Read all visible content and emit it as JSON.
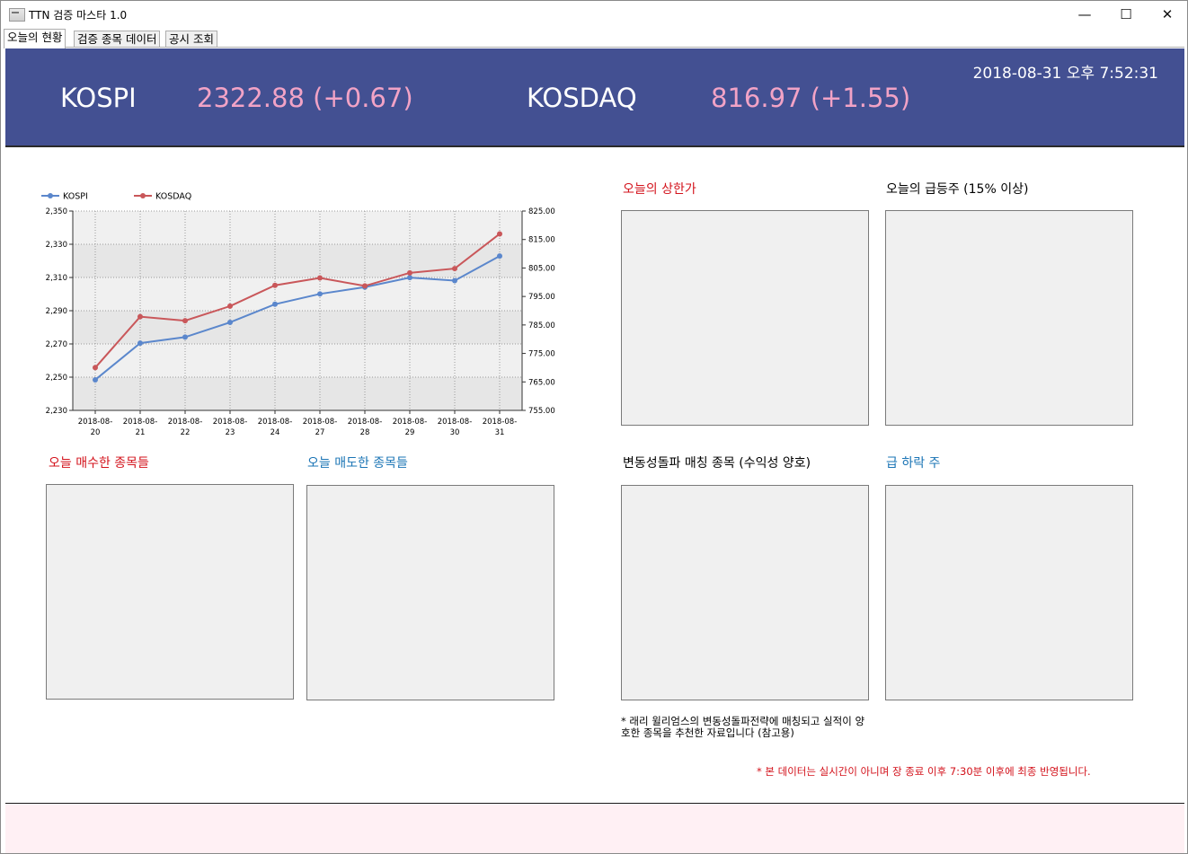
{
  "window": {
    "title": "TTN 검증 마스타 1.0",
    "controls": {
      "minimize": "—",
      "maximize": "☐",
      "close": "✕"
    }
  },
  "tabs": [
    {
      "label": "오늘의 현황",
      "active": true
    },
    {
      "label": "검증 종목 데이터",
      "active": false
    },
    {
      "label": "공시 조회",
      "active": false
    }
  ],
  "header": {
    "datetime": "2018-08-31 오후 7:52:31",
    "kospi": {
      "name": "KOSPI",
      "value": "2322.88 (+0.67)"
    },
    "kosdaq": {
      "name": "KOSDAQ",
      "value": "816.97 (+1.55)"
    },
    "colors": {
      "band": "#435092",
      "value": "#f2a3c6"
    }
  },
  "sections": {
    "upper_limit": "오늘의 상한가",
    "surge": "오늘의 급등주 (15% 이상)",
    "bought": "오늘 매수한 종목들",
    "sold": "오늘 매도한 종목들",
    "volatility": "변동성돌파 매칭 종목 (수익성 양호)",
    "plunge": "급 하락 주"
  },
  "notes": {
    "volatility_note": "* 래리 윌리엄스의 변동성돌파전략에 매칭되고 실적이 양호한 종목을 추천한 자료입니다 (참고용)",
    "footnote": "* 본 데이터는 실시간이 아니며 장 종료 이후 7:30분 이후에 최종 반영됩니다."
  },
  "chart_data": {
    "type": "line",
    "categories": [
      "2018-08-20",
      "2018-08-21",
      "2018-08-22",
      "2018-08-23",
      "2018-08-24",
      "2018-08-27",
      "2018-08-28",
      "2018-08-29",
      "2018-08-30",
      "2018-08-31"
    ],
    "category_lines": [
      [
        "2018-08-",
        "20"
      ],
      [
        "2018-08-",
        "21"
      ],
      [
        "2018-08-",
        "22"
      ],
      [
        "2018-08-",
        "23"
      ],
      [
        "2018-08-",
        "24"
      ],
      [
        "2018-08-",
        "27"
      ],
      [
        "2018-08-",
        "28"
      ],
      [
        "2018-08-",
        "29"
      ],
      [
        "2018-08-",
        "30"
      ],
      [
        "2018-08-",
        "31"
      ]
    ],
    "series": [
      {
        "name": "KOSPI",
        "axis": "left",
        "color": "#5b87cc",
        "values": [
          2248.4,
          2270.5,
          2274.1,
          2283.0,
          2293.9,
          2300.1,
          2304.2,
          2309.9,
          2308.1,
          2322.88
        ]
      },
      {
        "name": "KOSDAQ",
        "axis": "right",
        "color": "#c9575a",
        "values": [
          770.0,
          787.9,
          786.5,
          791.6,
          798.9,
          801.5,
          798.7,
          803.3,
          804.8,
          816.97
        ]
      }
    ],
    "y_left": {
      "min": 2230,
      "max": 2350,
      "ticks": [
        "2,230",
        "2,250",
        "2,270",
        "2,290",
        "2,310",
        "2,330",
        "2,350"
      ]
    },
    "y_right": {
      "min": 755,
      "max": 825,
      "ticks": [
        "755.00",
        "765.00",
        "775.00",
        "785.00",
        "795.00",
        "805.00",
        "815.00",
        "825.00"
      ]
    },
    "legend_position": "top-left",
    "grid": true
  }
}
